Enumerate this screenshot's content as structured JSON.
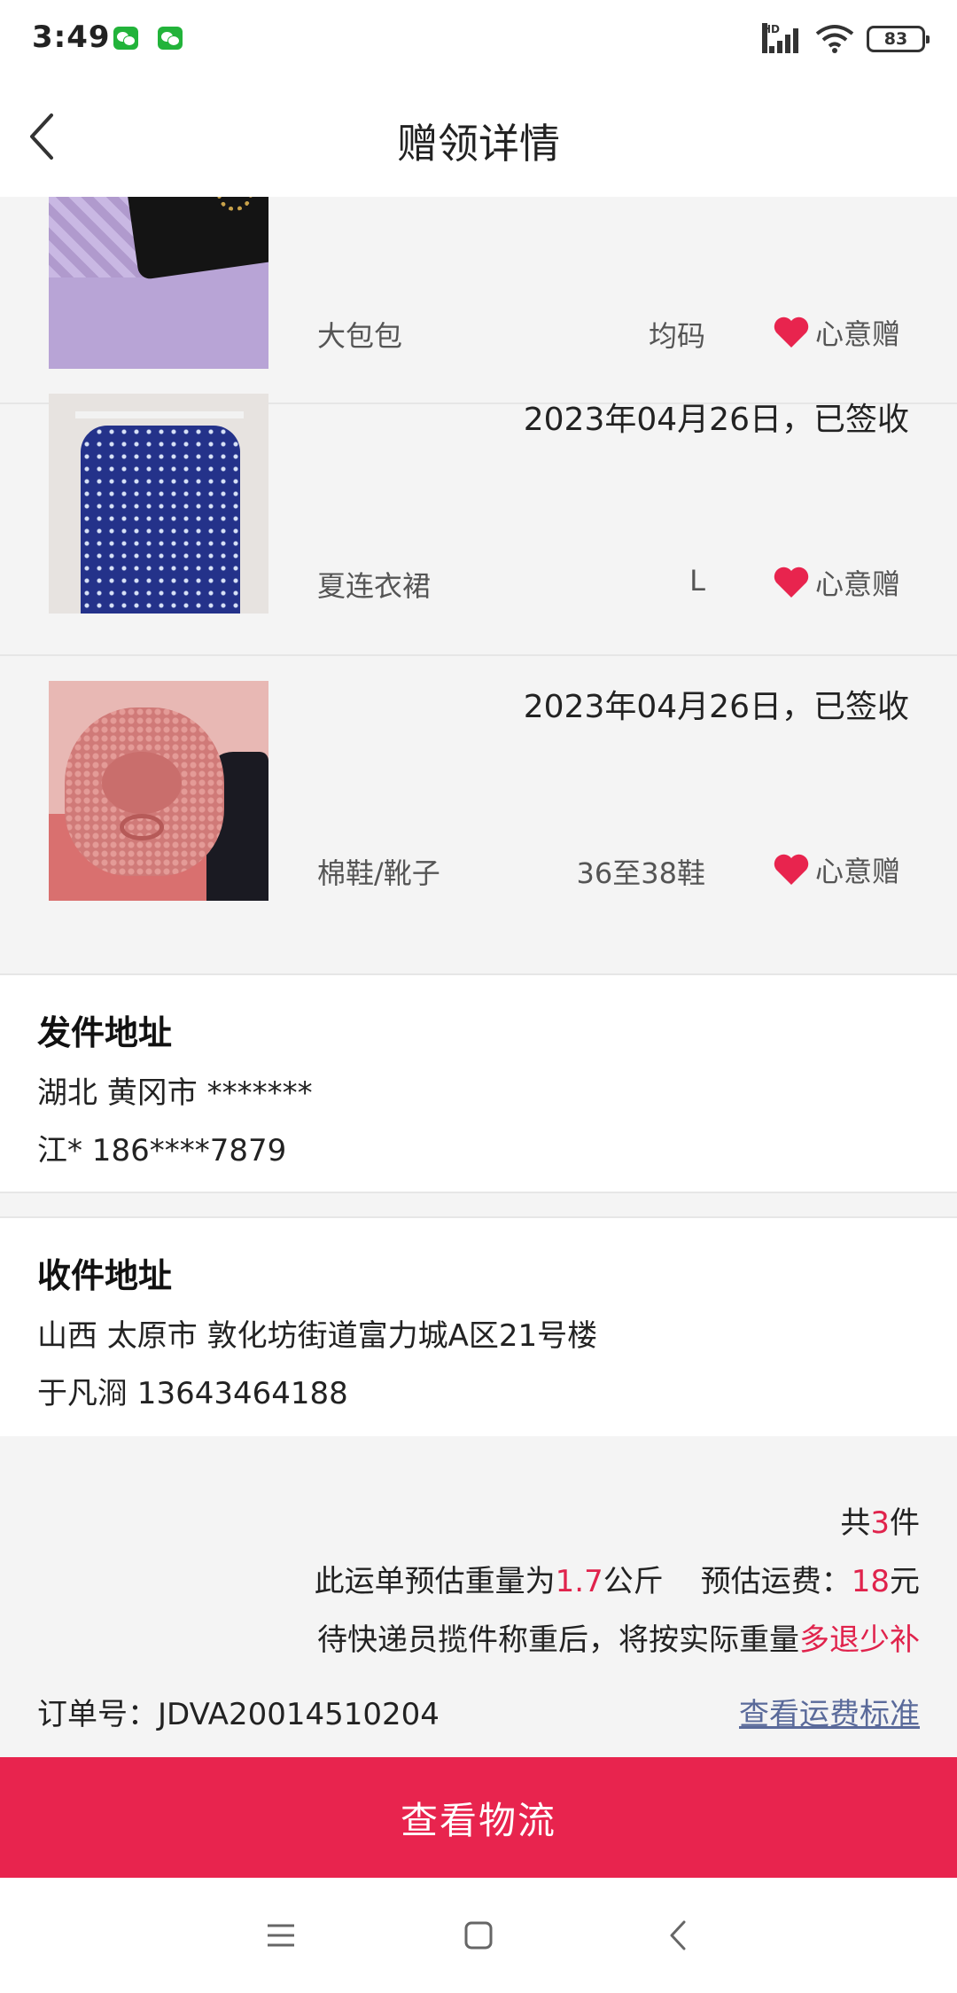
{
  "status_bar": {
    "time": "3:49",
    "notification_icons": [
      "wechat-icon",
      "wechat-icon"
    ],
    "network_label": "HD",
    "battery": "83"
  },
  "header": {
    "title": "赠领详情",
    "back_icon": "chevron-left-icon"
  },
  "items": [
    {
      "date": "",
      "name": "大包包",
      "size": "均码",
      "tag": "心意赠",
      "thumb": "bag"
    },
    {
      "date": "2023年04月26日，已签收",
      "name": "夏连衣裙",
      "size": "L",
      "tag": "心意赠",
      "thumb": "dress"
    },
    {
      "date": "2023年04月26日，已签收",
      "name": "棉鞋/靴子",
      "size": "36至38鞋",
      "tag": "心意赠",
      "thumb": "shoes"
    }
  ],
  "sender": {
    "title": "发件地址",
    "line1": "湖北 黄冈市 *******",
    "line2": "江* 186****7879"
  },
  "receiver": {
    "title": "收件地址",
    "line1": "山西 太原市 敦化坊街道富力城A区21号楼",
    "line2": "于凡浻 13643464188"
  },
  "summary": {
    "count_prefix": "共",
    "count": "3",
    "count_suffix": "件",
    "weight_prefix": "此运单预估重量为",
    "weight": "1.7",
    "weight_unit": "公斤",
    "fee_label": "预估运费：",
    "fee": "18",
    "fee_unit": "元",
    "note_prefix": "待快递员揽件称重后，将按实际重量",
    "note_highlight": "多退少补",
    "order_label": "订单号：",
    "order_number": "JDVA20014510204",
    "fee_standard_link": "查看运费标准"
  },
  "action": {
    "logistics_button": "查看物流"
  },
  "system_nav": [
    "menu-icon",
    "home-icon",
    "back-icon"
  ],
  "colors": {
    "accent": "#e8244e",
    "highlight_text": "#e0234c",
    "link": "#5a6a9a",
    "list_background": "#f4f4f4"
  }
}
